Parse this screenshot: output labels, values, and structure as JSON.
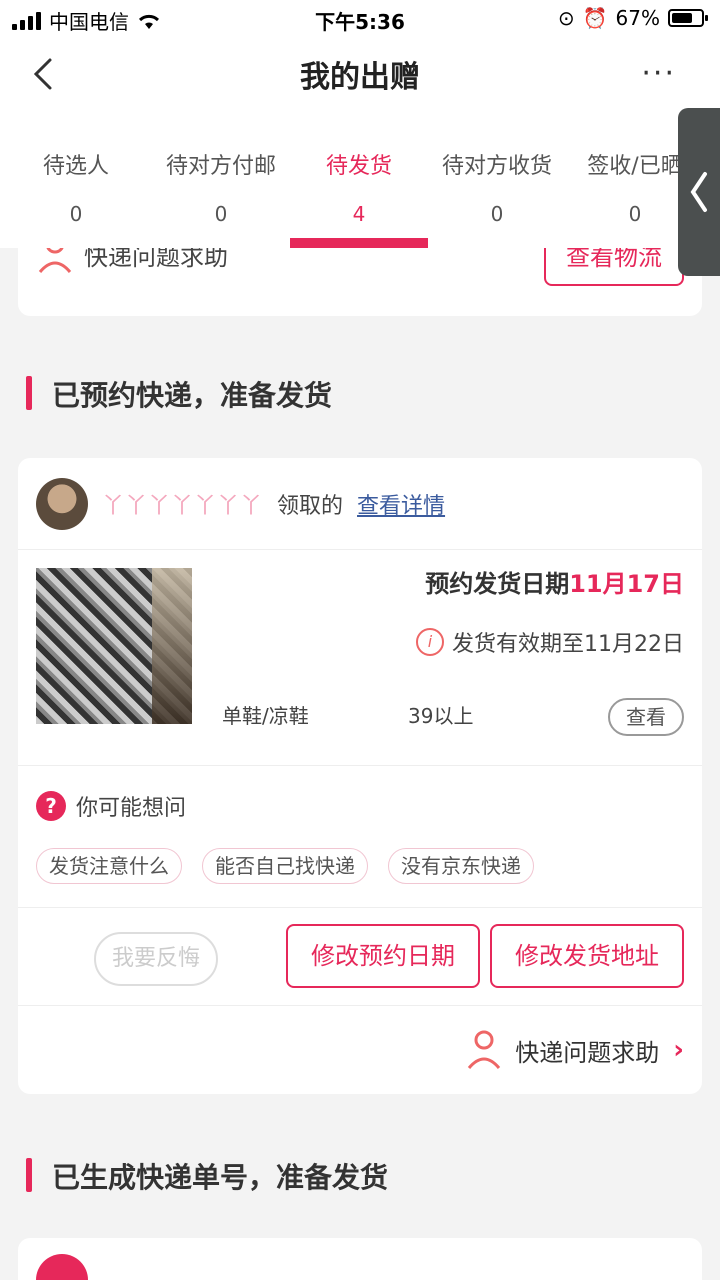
{
  "status_bar": {
    "carrier": "中国电信",
    "time": "下午5:36",
    "battery": "67%"
  },
  "nav": {
    "title": "我的出赠",
    "more": "···"
  },
  "tabs": [
    {
      "label": "待选人",
      "count": "0"
    },
    {
      "label": "待对方付邮",
      "count": "0"
    },
    {
      "label": "待发货",
      "count": "4",
      "active": true
    },
    {
      "label": "待对方收货",
      "count": "0"
    },
    {
      "label": "签收/已晒",
      "count": "0"
    }
  ],
  "partial_card": {
    "help_label": "快递问题求助",
    "logistics_button": "查看物流"
  },
  "section1": {
    "title": "已预约快递，准备发货"
  },
  "order": {
    "username": "丫丫丫丫丫丫丫",
    "claimed_label": "领取的",
    "details_link": "查看详情",
    "date_prefix": "预约发货日期",
    "date_value": "11月17日",
    "expire_text": "发货有效期至11月22日",
    "category": "单鞋/凉鞋",
    "size": "39以上",
    "view_button": "查看",
    "faq_title": "你可能想问",
    "faq_tags": [
      "发货注意什么",
      "能否自己找快递",
      "没有京东快递"
    ],
    "regret_button": "我要反悔",
    "modify_date_button": "修改预约日期",
    "modify_address_button": "修改发货地址",
    "help_label": "快递问题求助"
  },
  "section2": {
    "title": "已生成快递单号，准备发货"
  },
  "colors": {
    "accent": "#e6285a",
    "link": "#3b5b9e"
  }
}
